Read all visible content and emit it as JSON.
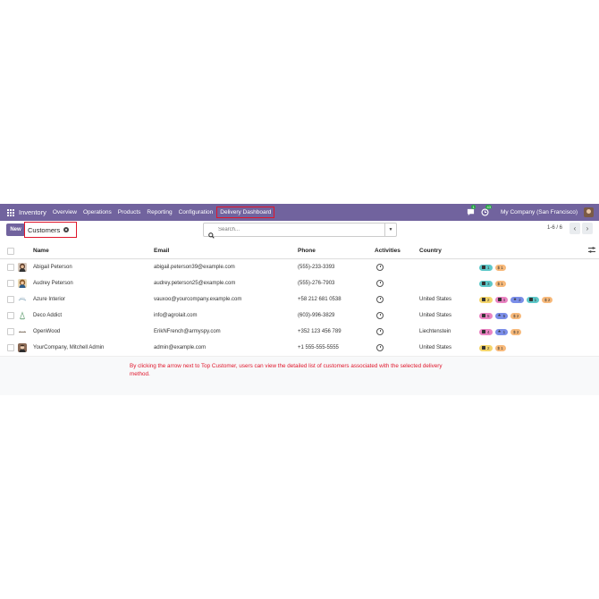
{
  "navbar": {
    "app_name": "Inventory",
    "menu": [
      "Overview",
      "Operations",
      "Products",
      "Reporting",
      "Configuration"
    ],
    "active_menu": "Delivery Dashboard",
    "messages_count": "1",
    "activities_count": "43",
    "company": "My Company (San Francisco)"
  },
  "control_panel": {
    "new_label": "New",
    "breadcrumb": "Customers",
    "search_placeholder": "Search...",
    "pager": "1-6 / 6"
  },
  "table": {
    "columns": {
      "name": "Name",
      "email": "Email",
      "phone": "Phone",
      "activities": "Activities",
      "country": "Country"
    },
    "rows": [
      {
        "name": "Abigail Peterson",
        "email": "abigail.peterson39@example.com",
        "phone": "(555)-233-3393",
        "country": "",
        "tags": [
          {
            "color": "teal",
            "icon": "briefcase-icon",
            "text": "1"
          },
          {
            "color": "orange",
            "icon": "dollar-icon",
            "text": "$ 1"
          }
        ]
      },
      {
        "name": "Audrey Peterson",
        "email": "audrey.peterson25@example.com",
        "phone": "(555)-276-7903",
        "country": "",
        "tags": [
          {
            "color": "teal",
            "icon": "briefcase-icon",
            "text": "3"
          },
          {
            "color": "orange",
            "icon": "dollar-icon",
            "text": "$ 1"
          }
        ]
      },
      {
        "name": "Azure Interior",
        "email": "vauxoo@yourcompany.example.com",
        "phone": "+58 212 681 0538",
        "country": "United States",
        "tags": [
          {
            "color": "yellow",
            "icon": "calendar-icon",
            "text": "2"
          },
          {
            "color": "pink",
            "icon": "edit-icon",
            "text": "4"
          },
          {
            "color": "blue",
            "icon": "star-icon",
            "text": "2"
          },
          {
            "color": "teal",
            "icon": "briefcase-icon",
            "text": "1"
          },
          {
            "color": "orange",
            "icon": "dollar-icon",
            "text": "$ 2"
          }
        ]
      },
      {
        "name": "Deco Addict",
        "email": "info@agrolait.com",
        "phone": "(603)-996-3829",
        "country": "United States",
        "tags": [
          {
            "color": "pink",
            "icon": "edit-icon",
            "text": "5"
          },
          {
            "color": "blue",
            "icon": "star-icon",
            "text": "5"
          },
          {
            "color": "orange",
            "icon": "dollar-icon",
            "text": "$ 2"
          }
        ]
      },
      {
        "name": "OpenWood",
        "email": "ErikNFrench@armyspy.com",
        "phone": "+352 123 456 789",
        "country": "Liechtenstein",
        "tags": [
          {
            "color": "pink",
            "icon": "edit-icon",
            "text": "4"
          },
          {
            "color": "blue",
            "icon": "star-icon",
            "text": "1"
          },
          {
            "color": "orange",
            "icon": "dollar-icon",
            "text": "$ 2"
          }
        ]
      },
      {
        "name": "YourCompany, Mitchell Admin",
        "email": "admin@example.com",
        "phone": "+1 555-555-5555",
        "country": "United States",
        "tags": [
          {
            "color": "yellow",
            "icon": "calendar-icon",
            "text": "2"
          },
          {
            "color": "orange",
            "icon": "dollar-icon",
            "text": "$ 1"
          }
        ]
      }
    ]
  },
  "annotation": "By clicking the arrow next to Top Customer, users can view the detailed list of customers associated with the selected delivery method.",
  "colors": {
    "brand": "#71639e",
    "highlight": "#e0162b"
  }
}
